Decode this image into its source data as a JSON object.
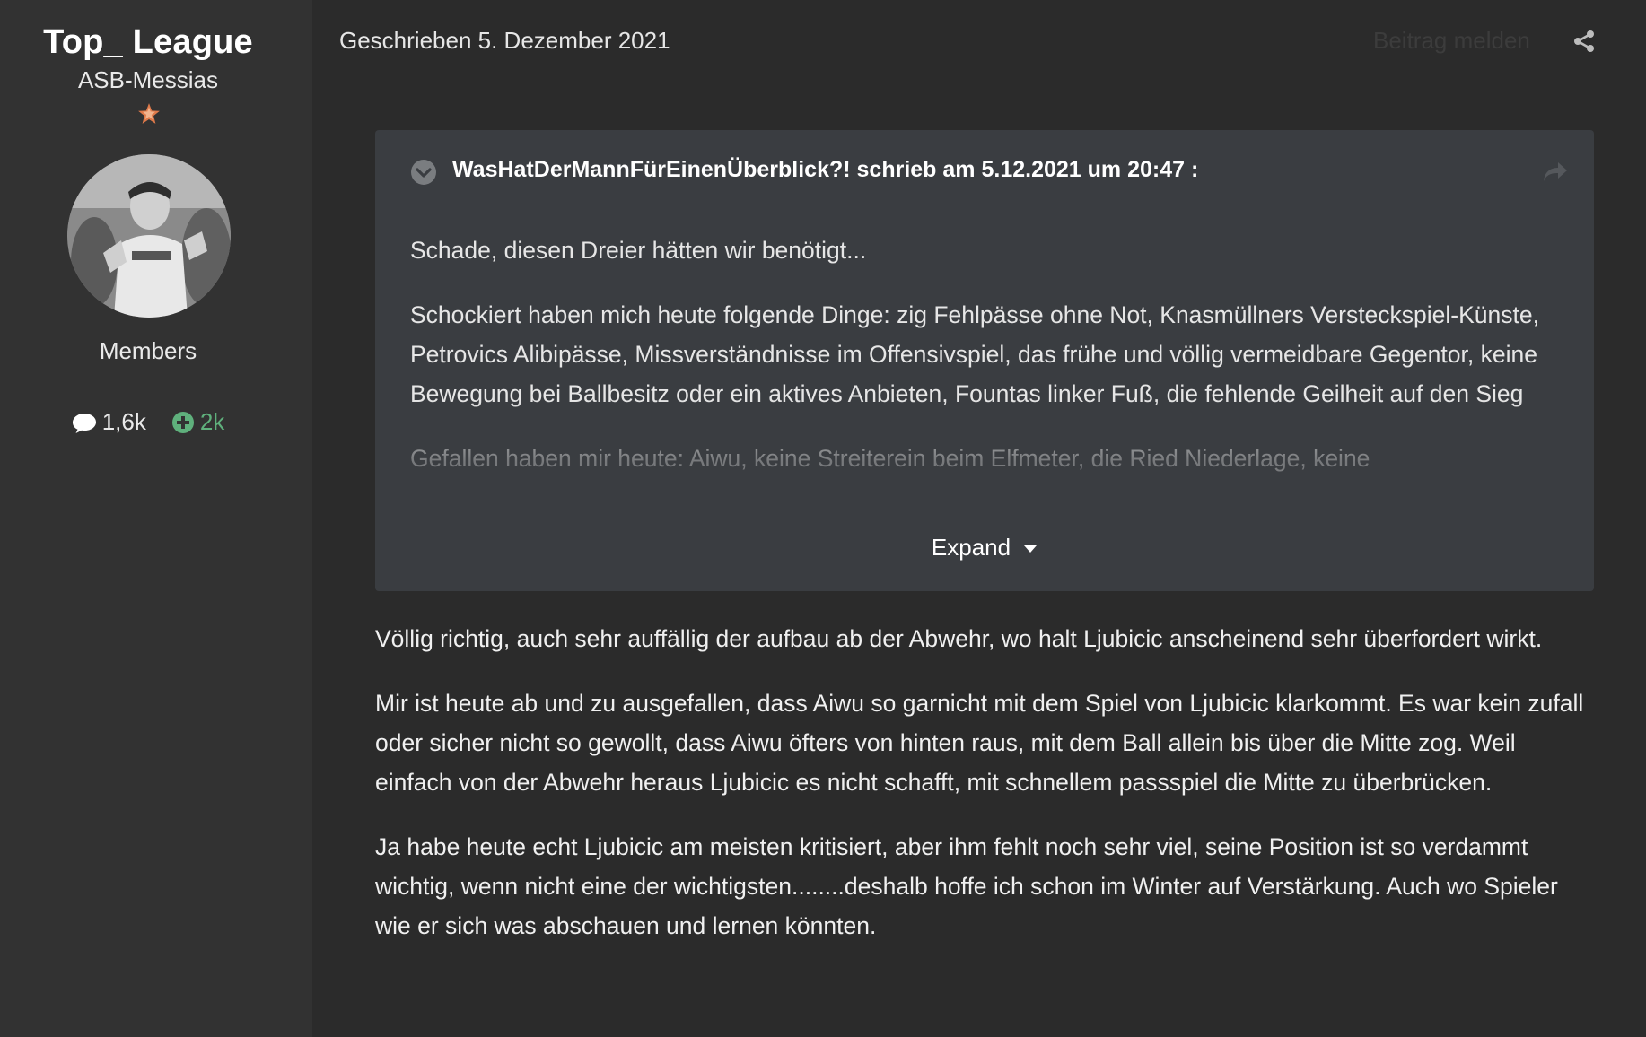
{
  "author": {
    "username": "Top_ League",
    "rank_title": "ASB-Messias",
    "rank_icon": "star-icon",
    "avatar_icon": "avatar-photo",
    "group": "Members",
    "post_count": "1,6k",
    "reputation": "2k"
  },
  "post": {
    "date_label": "Geschrieben 5. Dezember 2021",
    "report_label": "Beitrag melden",
    "share_icon": "share-icon",
    "quote": {
      "citation": "WasHatDerMannFürEinenÜberblick?! schrieb am 5.12.2021 um 20:47 :",
      "paragraphs": [
        "Schade, diesen Dreier hätten wir benötigt...",
        "Schockiert haben mich heute folgende Dinge: zig Fehlpässe ohne Not, Knasmüllners Versteckspiel-Künste, Petrovics Alibipässe, Missverständnisse im Offensivspiel, das frühe und völlig vermeidbare Gegentor, keine Bewegung bei Ballbesitz oder ein aktives Anbieten, Fountas linker Fuß, die fehlende Geilheit auf den Sieg",
        "Gefallen haben mir heute: Aiwu, keine Streiterein beim Elfmeter, die Ried Niederlage, keine"
      ],
      "expand_label": "Expand"
    },
    "paragraphs": [
      "Völlig richtig, auch sehr auffällig der aufbau ab der Abwehr, wo halt Ljubicic anscheinend sehr überfordert wirkt.",
      "Mir ist heute ab und zu ausgefallen, dass Aiwu so garnicht mit dem Spiel von  Ljubicic klarkommt. Es war kein zufall oder sicher nicht so gewollt, dass Aiwu öfters von hinten raus, mit dem  Ball allein bis über die Mitte zog. Weil einfach von der Abwehr heraus Ljubicic es nicht schafft, mit schnellem passspiel die Mitte zu überbrücken.",
      "Ja habe heute echt Ljubicic am meisten kritisiert, aber ihm fehlt noch sehr viel, seine Position ist so verdammt wichtig, wenn nicht eine der wichtigsten........deshalb hoffe ich schon im Winter auf Verstärkung. Auch wo Spieler wie er sich was abschauen und lernen könnten."
    ]
  },
  "colors": {
    "page_bg": "#2b2b2b",
    "sidebar_bg": "#323232",
    "quote_bg": "#3a3d41",
    "reputation_green": "#5fb07c",
    "rank_star": "#e07a4a"
  }
}
